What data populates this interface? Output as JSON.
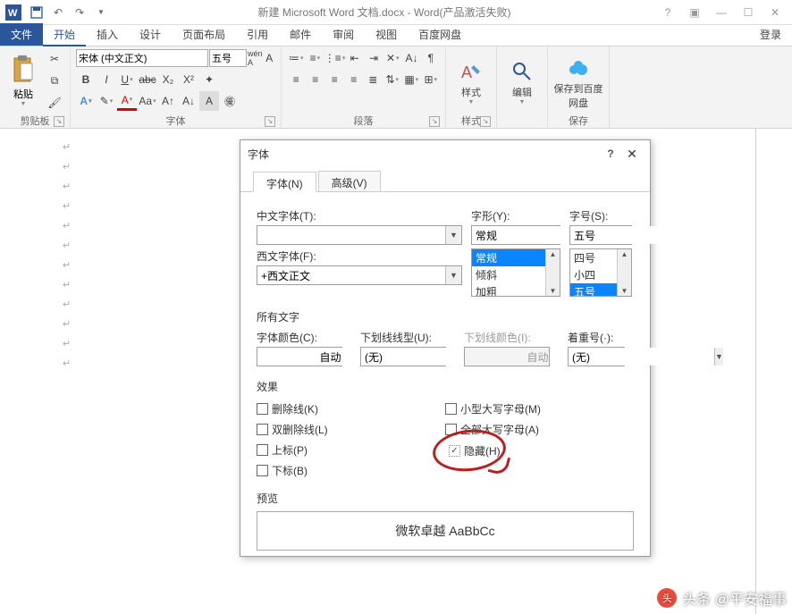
{
  "titlebar": {
    "title": "新建 Microsoft Word 文档.docx - Word(产品激活失败)"
  },
  "ribbon_tabs": {
    "file": "文件",
    "home": "开始",
    "insert": "插入",
    "design": "设计",
    "layout": "页面布局",
    "references": "引用",
    "mailings": "邮件",
    "review": "审阅",
    "view": "视图",
    "baidu": "百度网盘",
    "login": "登录"
  },
  "ribbon": {
    "clipboard": {
      "label": "剪贴板",
      "paste": "粘贴"
    },
    "font": {
      "label": "字体",
      "font_name": "宋体 (中文正文)",
      "font_size": "五号"
    },
    "paragraph": {
      "label": "段落"
    },
    "styles": {
      "label": "样式",
      "btn": "样式"
    },
    "editing": {
      "label": "编辑",
      "btn": "编辑"
    },
    "save": {
      "label": "保存",
      "btn": "保存到百度网盘"
    }
  },
  "dialog": {
    "title": "字体",
    "tab_font": "字体(N)",
    "tab_advanced": "高级(V)",
    "chinese_font_label": "中文字体(T):",
    "chinese_font_value": "",
    "western_font_label": "西文字体(F):",
    "western_font_value": "+西文正文",
    "style_label": "字形(Y):",
    "style_value": "常规",
    "style_options": [
      "常规",
      "倾斜",
      "加粗"
    ],
    "size_label": "字号(S):",
    "size_value": "五号",
    "size_options": [
      "四号",
      "小四",
      "五号"
    ],
    "all_text_label": "所有文字",
    "font_color_label": "字体颜色(C):",
    "font_color_value": "自动",
    "underline_type_label": "下划线线型(U):",
    "underline_type_value": "(无)",
    "underline_color_label": "下划线颜色(I):",
    "underline_color_value": "自动",
    "emphasis_label": "着重号(·):",
    "emphasis_value": "(无)",
    "effects_label": "效果",
    "strike": "删除线(K)",
    "double_strike": "双删除线(L)",
    "superscript": "上标(P)",
    "subscript": "下标(B)",
    "small_caps": "小型大写字母(M)",
    "all_caps": "全部大写字母(A)",
    "hidden": "隐藏(H)",
    "preview_label": "预览",
    "preview_text": "微软卓越 AaBbCc"
  },
  "watermark": {
    "prefix": "头条",
    "text": "@平安福事"
  }
}
